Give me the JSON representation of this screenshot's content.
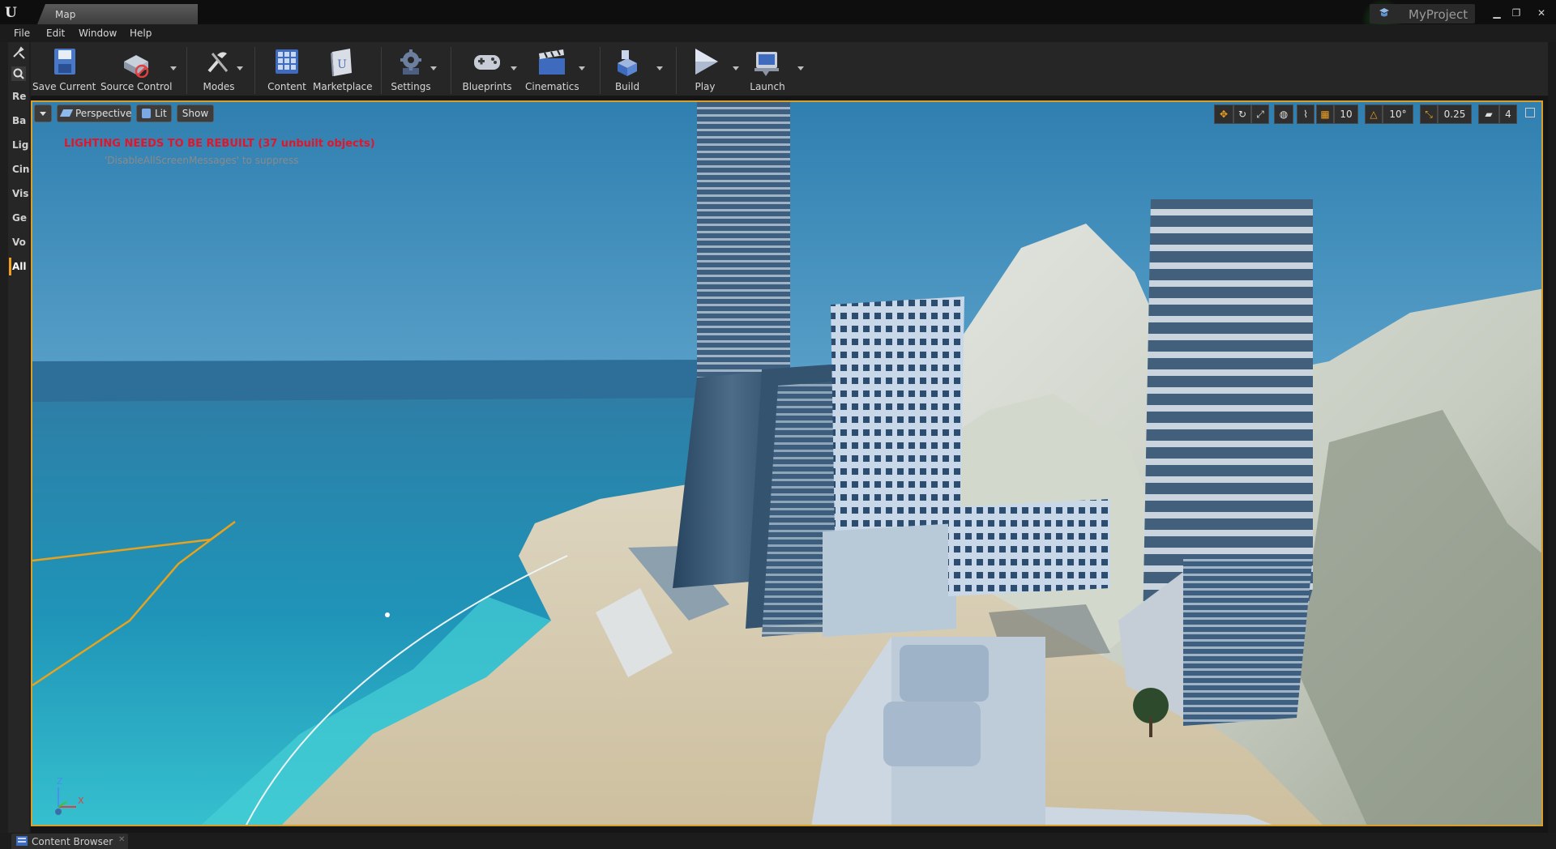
{
  "window": {
    "tab_title": "Map",
    "project_name": "MyProject",
    "controls": [
      "minimize",
      "restore",
      "close"
    ]
  },
  "menu": {
    "items": [
      "File",
      "Edit",
      "Window",
      "Help"
    ]
  },
  "left_panel": {
    "items": [
      "Re",
      "Ba",
      "Lig",
      "Cin",
      "Vis",
      "Ge",
      "Vo",
      "All"
    ],
    "active": "All"
  },
  "toolbar": {
    "buttons": [
      {
        "label": "Save Current",
        "icon": "save-icon",
        "dropdown": false
      },
      {
        "label": "Source Control",
        "icon": "source-control-icon",
        "dropdown": true
      },
      {
        "label": "Modes",
        "icon": "modes-icon",
        "dropdown": true
      },
      {
        "label": "Content",
        "icon": "content-icon",
        "dropdown": false
      },
      {
        "label": "Marketplace",
        "icon": "marketplace-icon",
        "dropdown": false
      },
      {
        "label": "Settings",
        "icon": "settings-icon",
        "dropdown": true
      },
      {
        "label": "Blueprints",
        "icon": "blueprints-icon",
        "dropdown": true
      },
      {
        "label": "Cinematics",
        "icon": "cinematics-icon",
        "dropdown": true
      },
      {
        "label": "Build",
        "icon": "build-icon",
        "dropdown": true
      },
      {
        "label": "Play",
        "icon": "play-icon",
        "dropdown": true
      },
      {
        "label": "Launch",
        "icon": "launch-icon",
        "dropdown": true
      }
    ]
  },
  "viewport": {
    "view_mode": "Perspective",
    "lighting": "Lit",
    "show_label": "Show",
    "warning": "LIGHTING NEEDS TO BE REBUILT (37 unbuilt objects)",
    "hint": "'DisableAllScreenMessages' to suppress",
    "grid_snap": "10",
    "rotation_snap": "10°",
    "scale_snap": "0.25",
    "camera_speed": "4",
    "axis_labels": {
      "z": "Z",
      "x": "X"
    }
  },
  "bottom": {
    "content_browser_label": "Content Browser"
  },
  "colors": {
    "selection_border": "#d8a02a",
    "warning_text": "#e2162a",
    "snap_active": "#e0a020"
  }
}
